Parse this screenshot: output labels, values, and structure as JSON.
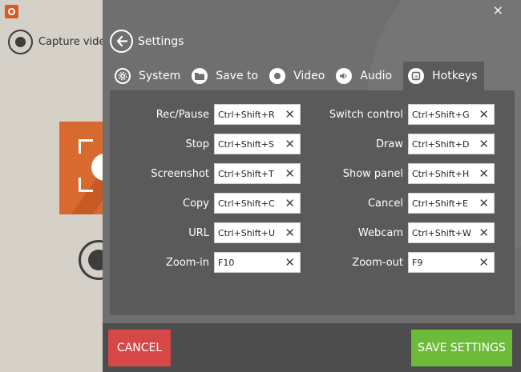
{
  "background_app": {
    "capture_label": "Capture video"
  },
  "settings": {
    "title": "Settings",
    "close_glyph": "×",
    "tabs": [
      {
        "label": "System",
        "icon": "gear-icon"
      },
      {
        "label": "Save to",
        "icon": "folder-icon"
      },
      {
        "label": "Video",
        "icon": "record-icon"
      },
      {
        "label": "Audio",
        "icon": "speaker-icon"
      },
      {
        "label": "Hotkeys",
        "icon": "keyboard-icon",
        "active": true
      }
    ],
    "hotkeys_left": [
      {
        "label": "Rec/Pause",
        "value": "Ctrl+Shift+R"
      },
      {
        "label": "Stop",
        "value": "Ctrl+Shift+S"
      },
      {
        "label": "Screenshot",
        "value": "Ctrl+Shift+T"
      },
      {
        "label": "Copy",
        "value": "Ctrl+Shift+C"
      },
      {
        "label": "URL",
        "value": "Ctrl+Shift+U"
      },
      {
        "label": "Zoom-in",
        "value": "F10"
      }
    ],
    "hotkeys_right": [
      {
        "label": "Switch control",
        "value": "Ctrl+Shift+G"
      },
      {
        "label": "Draw",
        "value": "Ctrl+Shift+D"
      },
      {
        "label": "Show panel",
        "value": "Ctrl+Shift+H"
      },
      {
        "label": "Cancel",
        "value": "Ctrl+Shift+E"
      },
      {
        "label": "Webcam",
        "value": "Ctrl+Shift+W"
      },
      {
        "label": "Zoom-out",
        "value": "F9"
      }
    ],
    "clear_glyph": "✕",
    "cancel_label": "CANCEL",
    "save_label": "SAVE SETTINGS"
  },
  "colors": {
    "overlay_bg": "#6f6f6f",
    "panel_bg": "#5a5a5a",
    "footer_bg": "#4d4d4d",
    "cancel": "#d64848",
    "save": "#6dbb3b",
    "accent_orange": "#d86a2f"
  }
}
